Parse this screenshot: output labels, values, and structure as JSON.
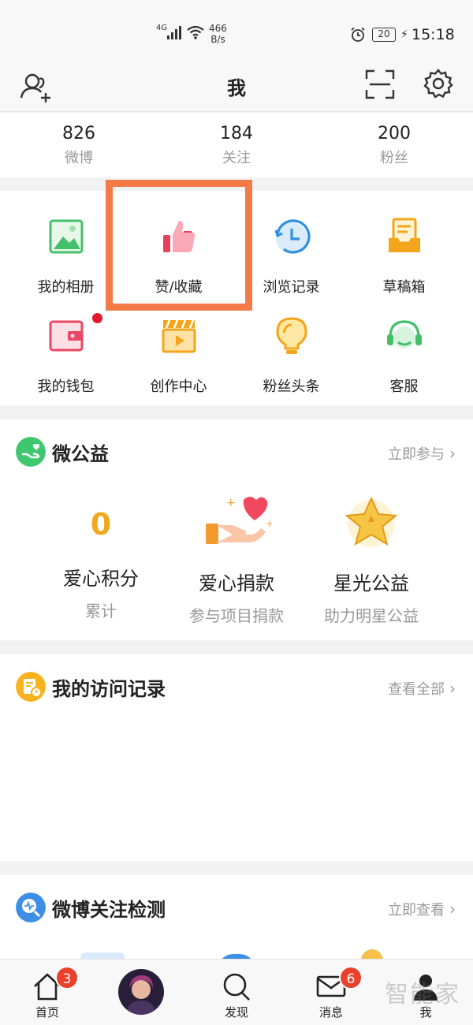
{
  "status_bar": {
    "network": "4G",
    "speed_value": "466",
    "speed_unit": "B/s",
    "battery": "20",
    "time": "15:18"
  },
  "header": {
    "title": "我"
  },
  "stats": [
    {
      "value": "826",
      "label": "微博"
    },
    {
      "value": "184",
      "label": "关注"
    },
    {
      "value": "200",
      "label": "粉丝"
    }
  ],
  "quick_tiles": [
    {
      "label": "我的相册",
      "icon": "album-icon"
    },
    {
      "label": "赞/收藏",
      "icon": "thumb-up-icon"
    },
    {
      "label": "浏览记录",
      "icon": "history-clock-icon"
    },
    {
      "label": "草稿箱",
      "icon": "draft-box-icon"
    },
    {
      "label": "我的钱包",
      "icon": "wallet-icon"
    },
    {
      "label": "创作中心",
      "icon": "clapperboard-icon"
    },
    {
      "label": "粉丝头条",
      "icon": "lightbulb-icon"
    },
    {
      "label": "客服",
      "icon": "headset-icon"
    }
  ],
  "charity": {
    "title": "微公益",
    "link": "立即参与",
    "items": [
      {
        "top": "0",
        "big": "爱心积分",
        "small": "累计"
      },
      {
        "big": "爱心捐款",
        "small": "参与项目捐款"
      },
      {
        "big": "星光公益",
        "small": "助力明星公益"
      }
    ]
  },
  "visits": {
    "title": "我的访问记录",
    "link": "查看全部"
  },
  "follow_check": {
    "title": "微博关注检测",
    "link": "立即查看"
  },
  "bottom_nav": {
    "home": {
      "label": "首页",
      "badge": "3"
    },
    "discover": {
      "label": "发现"
    },
    "messages": {
      "label": "消息",
      "badge": "6"
    },
    "me": {
      "label": "我"
    }
  },
  "watermark": "智能家",
  "colors": {
    "highlight_border": "#f47a48",
    "badge": "#e8412c",
    "charity_points": "#f0a81c"
  }
}
